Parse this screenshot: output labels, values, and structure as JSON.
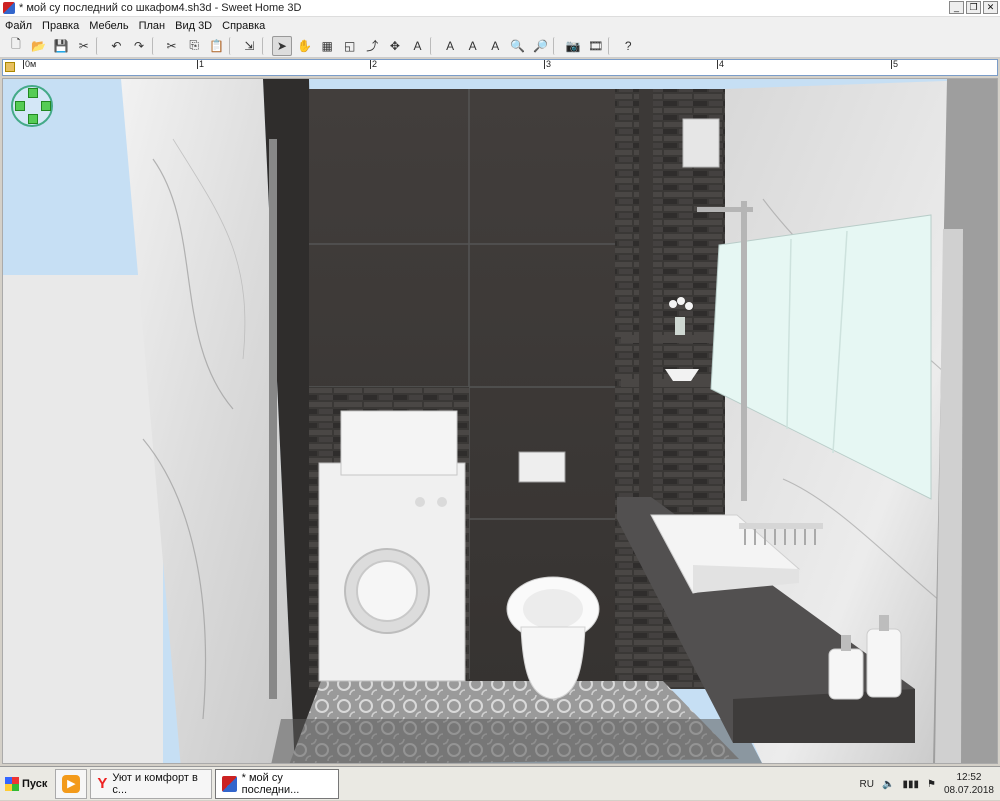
{
  "window": {
    "title": "* мой су последний со шкафом4.sh3d - Sweet Home 3D",
    "buttons": [
      "_",
      "❐",
      "✕"
    ]
  },
  "menu": [
    "Файл",
    "Правка",
    "Мебель",
    "План",
    "Вид 3D",
    "Справка"
  ],
  "toolbar": {
    "icons": [
      "new-document-icon",
      "open-icon",
      "save-icon",
      "cut-preferences-icon",
      "undo-icon",
      "redo-icon",
      "cut-icon",
      "copy-icon",
      "paste-icon",
      "add-furniture-icon",
      "select-icon",
      "pan-icon",
      "create-walls-icon",
      "create-rooms-icon",
      "create-polylines-icon",
      "create-dimensions-icon",
      "add-text-icon",
      "text-style-icon",
      "bold-icon",
      "italic-icon",
      "zoom-in-icon",
      "zoom-out-icon",
      "photo-icon",
      "video-icon",
      "help-icon"
    ]
  },
  "ruler": {
    "labels": [
      "0м",
      "1",
      "2",
      "3",
      "4",
      "5"
    ]
  },
  "taskbar": {
    "start_label": "Пуск",
    "tasks": [
      {
        "label": "",
        "icon": "media-player-icon"
      },
      {
        "label": "Уют и комфорт в с...",
        "icon": "yandex-browser-icon"
      },
      {
        "label": "* мой су последни...",
        "icon": "sweet-home-3d-icon",
        "active": true
      }
    ],
    "language": "RU",
    "time": "12:52",
    "date": "08.07.2018"
  },
  "colors": {
    "sky": "#c6dff4",
    "dark_tile": "#3d3a39",
    "marble": "#e6e6e6",
    "countertop": "#525050",
    "mirror": "#e6f7f3"
  }
}
